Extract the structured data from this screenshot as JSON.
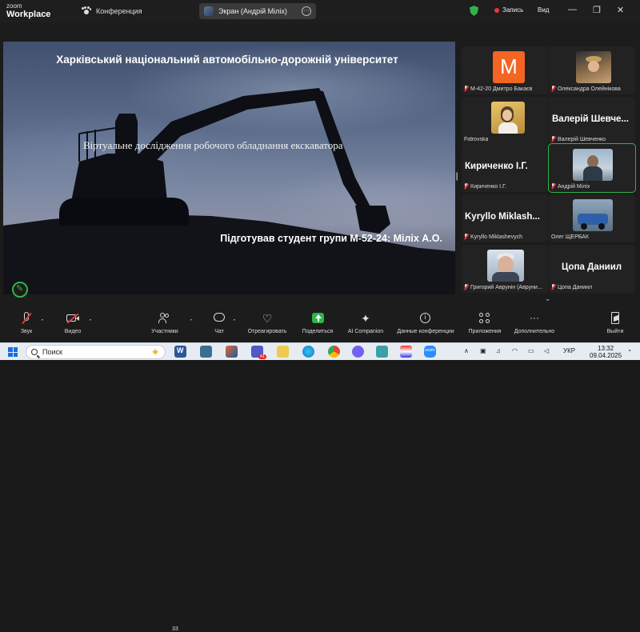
{
  "titlebar": {
    "logo_line1": "zoom",
    "logo_line2": "Workplace",
    "conference_label": "Конференция",
    "screen_share_label": "Экран (Андрій Міліх)",
    "more_symbol": "···",
    "record_label": "Запись",
    "view_label": "Вид",
    "win_minimize": "—",
    "win_restore": "❐",
    "win_close": "✕",
    "shield_color": "#2fb34a"
  },
  "slide": {
    "title": "Харківський національний автомобільно-дорожній університет",
    "subtitle": "Віртуальне дослідження робочого обладнання екскаватора",
    "author": "Підготував студент групи М-52-24: Міліх А.О."
  },
  "participants": [
    {
      "name": "М-42-20 Дмитро Бакаєв",
      "avatar_letter": "M",
      "avatar_color": "#f26522",
      "muted": true
    },
    {
      "name": "Олександра Олейнікова",
      "muted": true
    },
    {
      "name": "Fidrovska",
      "muted": false
    },
    {
      "name": "Валерій Шевченко",
      "display": "Валерій  Шевче...",
      "muted": true
    },
    {
      "name": "Кириченко І.Г.",
      "display": "Кириченко І.Г.",
      "muted": true
    },
    {
      "name": "Андрій Міліх",
      "muted": true,
      "active": true
    },
    {
      "name": "Kyryllo Miklashevych",
      "display": "Kyryllo  Miklash...",
      "muted": true
    },
    {
      "name": "Олег ЩЕРБАК",
      "muted": false
    },
    {
      "name": "Григорій Аврунін (Аврунін Г.А.)",
      "label": "Григорий Аврунін (Авруни...",
      "muted": true
    },
    {
      "name": "Цопа Даниил",
      "display": "Цопа  Даниил",
      "muted": true
    }
  ],
  "toolbar": {
    "audio": "Звук",
    "video": "Видео",
    "participants": "Участники",
    "participants_count": "33",
    "chat": "Чат",
    "react": "Отреагировать",
    "share": "Поделиться",
    "ai": "AI Companion",
    "info": "Данные конференции",
    "apps": "Приложения",
    "more": "Дополнительно",
    "leave": "Выйти",
    "share_color": "#2fb34a",
    "leave_color": "#e23b3b"
  },
  "taskbar": {
    "search_placeholder": "Поиск",
    "teams_badge": "41",
    "lang": "УКР",
    "time": "13:32",
    "date": "09.04.2025"
  }
}
